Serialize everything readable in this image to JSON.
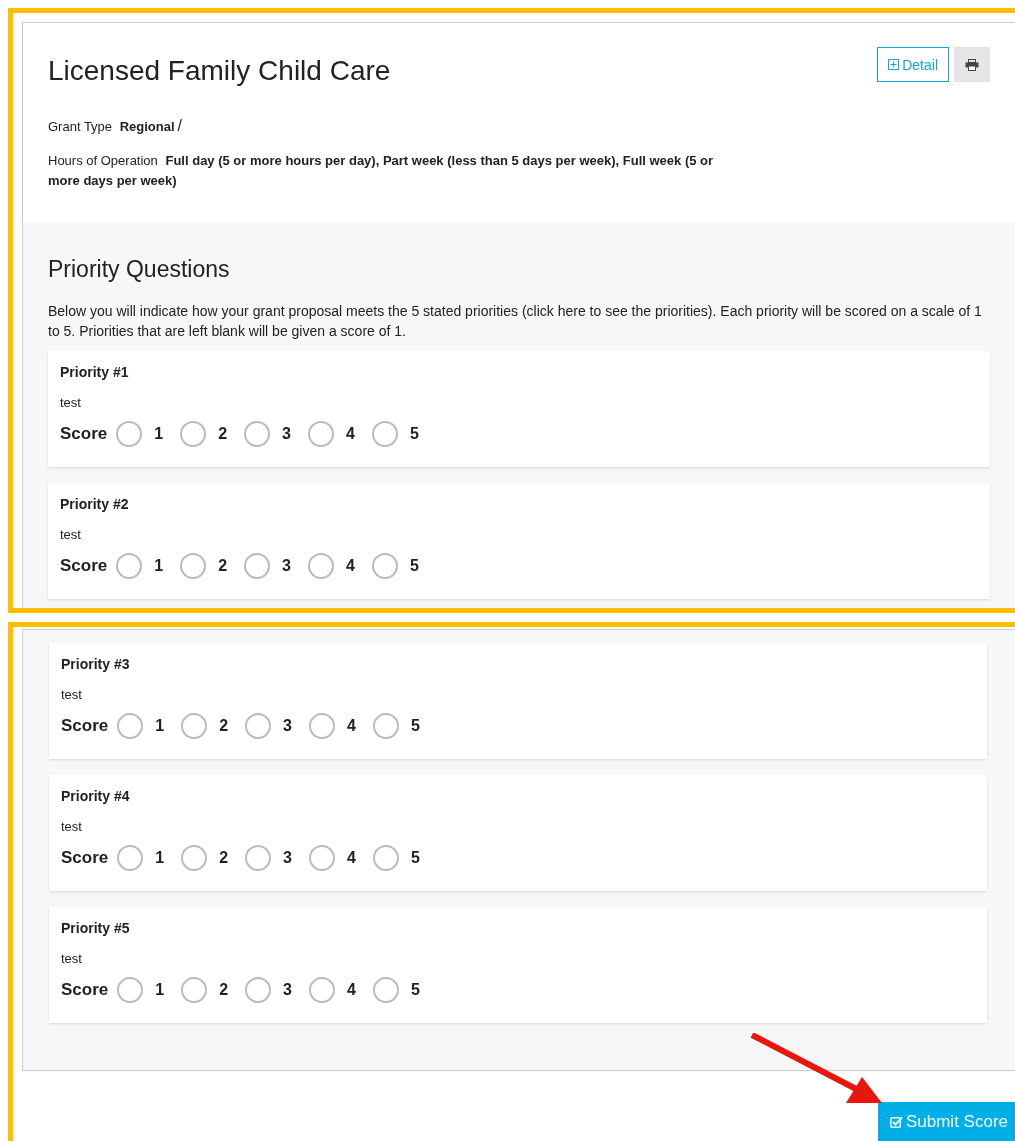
{
  "header": {
    "title": "Licensed Family Child Care",
    "detail_button": "Detail",
    "fields": [
      {
        "label": "Grant Type",
        "value": "Regional",
        "suffix": "/"
      },
      {
        "label": "Hours of Operation",
        "value": "Full day (5 or more hours per day), Part week (less than 5 days per week), Full week (5 or more days per week)"
      }
    ]
  },
  "priority_section": {
    "title": "Priority Questions",
    "intro": "Below you will indicate how your grant proposal meets the 5 stated priorities (click here to see the priorities). Each priority will be scored on a scale of 1 to 5. Priorities that are left blank will be given a score of 1."
  },
  "screenshots": [
    {
      "priorities": [
        {
          "title": "Priority #1",
          "text": "test",
          "score_label": "Score",
          "options": [
            {
              "label": "1",
              "selected": false
            },
            {
              "label": "2",
              "selected": false
            },
            {
              "label": "3",
              "selected": false
            },
            {
              "label": "4",
              "selected": false
            },
            {
              "label": "5",
              "selected": false
            }
          ]
        },
        {
          "title": "Priority #2",
          "text": "test",
          "score_label": "Score",
          "options": [
            {
              "label": "1",
              "selected": false
            },
            {
              "label": "2",
              "selected": false
            },
            {
              "label": "3",
              "selected": false
            },
            {
              "label": "4",
              "selected": false
            },
            {
              "label": "5",
              "selected": false
            }
          ]
        }
      ]
    },
    {
      "priorities": [
        {
          "title": "Priority #3",
          "text": "test",
          "score_label": "Score",
          "options": [
            {
              "label": "1",
              "selected": false
            },
            {
              "label": "2",
              "selected": false
            },
            {
              "label": "3",
              "selected": false
            },
            {
              "label": "4",
              "selected": false
            },
            {
              "label": "5",
              "selected": false
            }
          ]
        },
        {
          "title": "Priority #4",
          "text": "test",
          "score_label": "Score",
          "options": [
            {
              "label": "1",
              "selected": false
            },
            {
              "label": "2",
              "selected": false
            },
            {
              "label": "3",
              "selected": false
            },
            {
              "label": "4",
              "selected": false
            },
            {
              "label": "5",
              "selected": false
            }
          ]
        },
        {
          "title": "Priority #5",
          "text": "test",
          "score_label": "Score",
          "options": [
            {
              "label": "1",
              "selected": false
            },
            {
              "label": "2",
              "selected": false
            },
            {
              "label": "3",
              "selected": false
            },
            {
              "label": "4",
              "selected": false
            },
            {
              "label": "5",
              "selected": false
            }
          ]
        }
      ]
    }
  ],
  "submit_button": "Submit Score"
}
